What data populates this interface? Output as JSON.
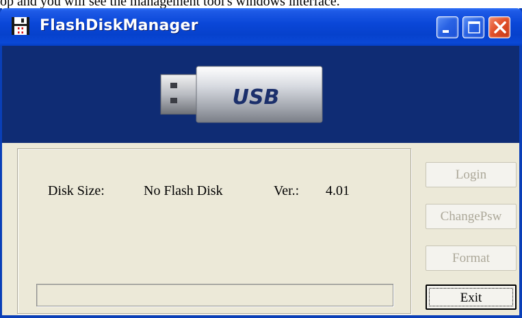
{
  "document": {
    "text_fragment": "op and you will see the management tool's windows interface."
  },
  "window": {
    "title": "FlashDiskManager",
    "app_icon": "floppy-disk-icon",
    "controls": {
      "minimize_icon": "minimize-icon",
      "maximize_icon": "maximize-icon",
      "close_icon": "close-icon"
    }
  },
  "banner": {
    "usb_label": "USB",
    "accent_color": "#0f2c74"
  },
  "info": {
    "disk_size_label": "Disk Size:",
    "disk_size_value": "No Flash Disk",
    "version_label": "Ver.:",
    "version_value": "4.01"
  },
  "progress": {
    "percent": 0
  },
  "buttons": {
    "login": {
      "label": "Login",
      "enabled": false
    },
    "change_psw": {
      "label": "ChangePsw",
      "enabled": false
    },
    "format": {
      "label": "Format",
      "enabled": false
    },
    "exit": {
      "label": "Exit",
      "enabled": true,
      "focused": true
    }
  },
  "colors": {
    "titlebar_blue": "#0a47d8",
    "window_bg": "#ece9d8",
    "disabled_text": "#aca899",
    "close_red": "#e2512a"
  }
}
